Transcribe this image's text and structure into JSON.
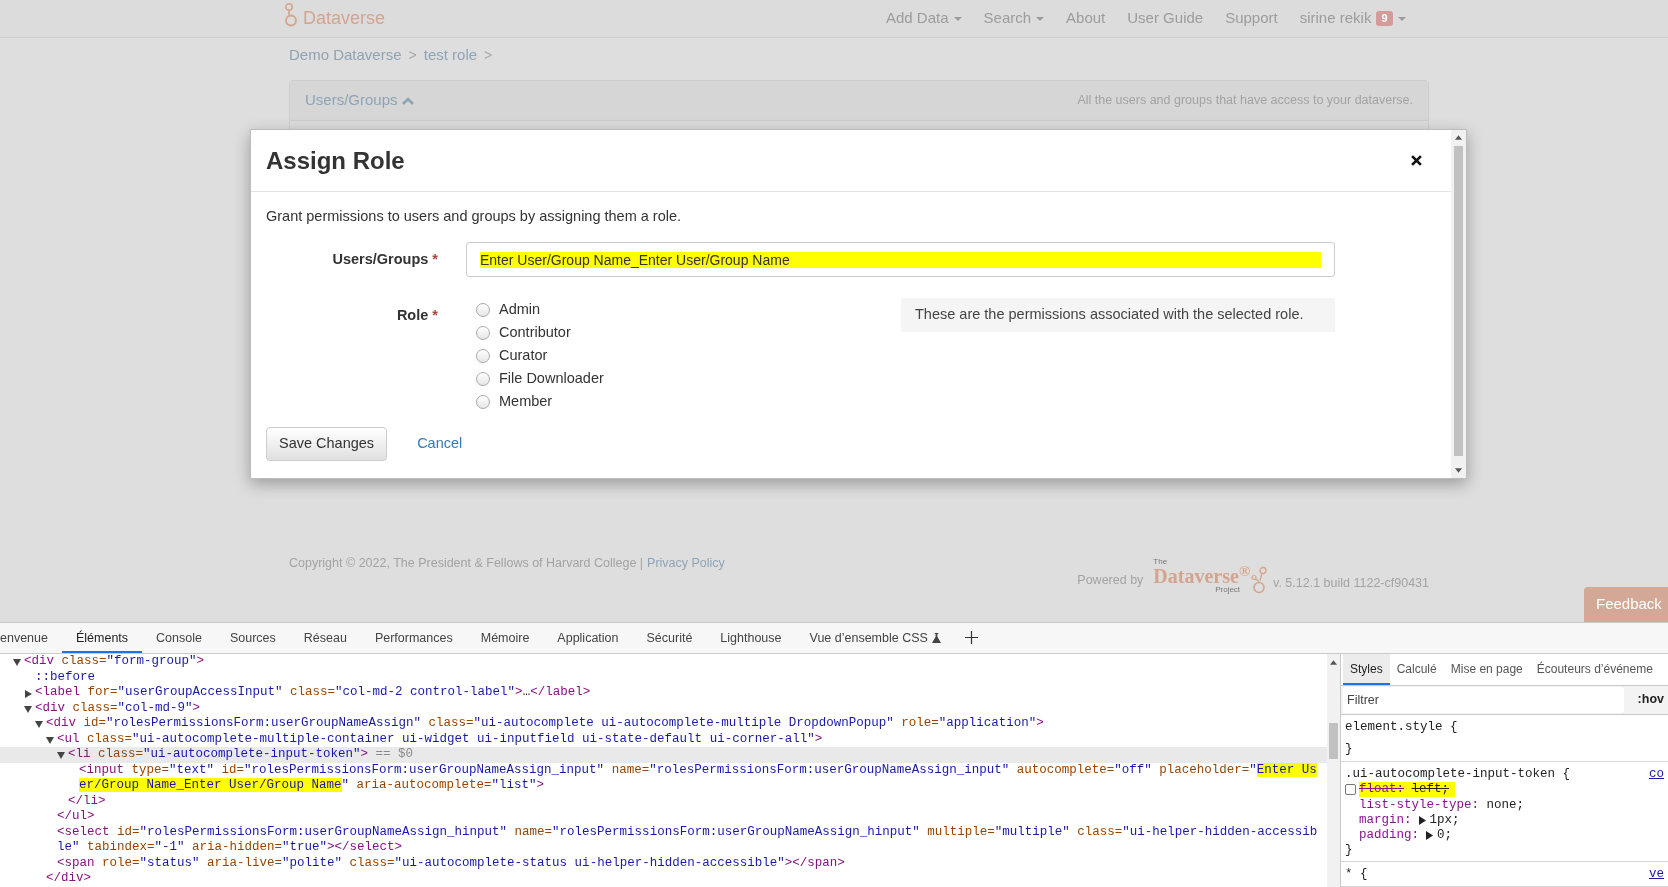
{
  "navbar": {
    "brand": "Dataverse",
    "items": [
      {
        "label": "Add Data",
        "dropdown": true
      },
      {
        "label": "Search",
        "dropdown": true
      },
      {
        "label": "About",
        "dropdown": false
      },
      {
        "label": "User Guide",
        "dropdown": false
      },
      {
        "label": "Support",
        "dropdown": false
      },
      {
        "label": "sirine rekik",
        "dropdown": true,
        "badge": "9"
      }
    ]
  },
  "breadcrumb": {
    "separator": ">",
    "items": [
      "Demo Dataverse",
      "test role"
    ]
  },
  "panel": {
    "title": "Users/Groups",
    "expanded": true,
    "description": "All the users and groups that have access to your dataverse."
  },
  "modal": {
    "title": "Assign Role",
    "intro": "Grant permissions to users and groups by assigning them a role.",
    "users_field": {
      "label": "Users/Groups",
      "required_mark": "*",
      "placeholder": "Enter User/Group Name_Enter User/Group Name",
      "highlight": true
    },
    "role": {
      "label": "Role",
      "required_mark": "*",
      "options": [
        {
          "label": "Admin",
          "selected": false
        },
        {
          "label": "Contributor",
          "selected": false
        },
        {
          "label": "Curator",
          "selected": false
        },
        {
          "label": "File Downloader",
          "selected": false
        },
        {
          "label": "Member",
          "selected": false
        }
      ]
    },
    "permissions_note": "These are the permissions associated with the selected role.",
    "buttons": [
      {
        "label": "Save Changes",
        "kind": "button"
      },
      {
        "label": "Cancel",
        "kind": "link"
      }
    ]
  },
  "footer": {
    "copyright": "Copyright © 2022, The President & Fellows of Harvard College |",
    "privacy_link": "Privacy Policy",
    "powered_by": "Powered by",
    "logo": {
      "top": "The",
      "name": "Dataverse$^{®}$",
      "bottom": "Project"
    },
    "version": "v. 5.12.1 build 1122-cf90431"
  },
  "feedback": "Feedback",
  "devtools": {
    "tabs": [
      {
        "label": "envenue",
        "selected": false
      },
      {
        "label": "Éléments",
        "selected": true
      },
      {
        "label": "Console",
        "selected": false
      },
      {
        "label": "Sources",
        "selected": false
      },
      {
        "label": "Réseau",
        "selected": false
      },
      {
        "label": "Performances",
        "selected": false
      },
      {
        "label": "Mémoire",
        "selected": false
      },
      {
        "label": "Application",
        "selected": false
      },
      {
        "label": "Sécurité",
        "selected": false
      },
      {
        "label": "Lighthouse",
        "selected": false
      },
      {
        "label": "Vue d’ensemble CSS",
        "selected": false,
        "experimental": true
      }
    ],
    "dom_tree": [
      {
        "selected": false,
        "expanded": true,
        "open": [
          {
            "kind": "tag",
            "text": "<div"
          },
          {
            "kind": "attr",
            "text": " class="
          },
          {
            "kind": "val",
            "text": "\"form-group\""
          },
          {
            "kind": "tag",
            "text": ">"
          }
        ],
        "children": [
          {
            "selected": false,
            "open": [
              {
                "kind": "pseudo",
                "text": "::before"
              }
            ]
          },
          {
            "selected": false,
            "expanded": false,
            "open": [
              {
                "kind": "tag",
                "text": "<label"
              },
              {
                "kind": "attr",
                "text": " for="
              },
              {
                "kind": "val",
                "text": "\"userGroupAccessInput\""
              },
              {
                "kind": "attr",
                "text": " class="
              },
              {
                "kind": "val",
                "text": "\"col-md-2 control-label\""
              },
              {
                "kind": "tag",
                "text": ">"
              },
              {
                "kind": "plain",
                "text": "…"
              },
              {
                "kind": "tag",
                "text": "</label>"
              }
            ]
          },
          {
            "selected": false,
            "expanded": true,
            "open": [
              {
                "kind": "tag",
                "text": "<div"
              },
              {
                "kind": "attr",
                "text": " class="
              },
              {
                "kind": "val",
                "text": "\"col-md-9\""
              },
              {
                "kind": "tag",
                "text": ">"
              }
            ],
            "children": [
              {
                "selected": false,
                "expanded": true,
                "open": [
                  {
                    "kind": "tag",
                    "text": "<div"
                  },
                  {
                    "kind": "attr",
                    "text": " id="
                  },
                  {
                    "kind": "val",
                    "text": "\"rolesPermissionsForm:userGroupNameAssign\""
                  },
                  {
                    "kind": "attr",
                    "text": " class="
                  },
                  {
                    "kind": "val",
                    "text": "\"ui-autocomplete ui-autocomplete-multiple DropdownPopup\""
                  },
                  {
                    "kind": "attr",
                    "text": " role="
                  },
                  {
                    "kind": "val",
                    "text": "\"application\""
                  },
                  {
                    "kind": "tag",
                    "text": ">"
                  }
                ],
                "close": [
                  {
                    "kind": "tag",
                    "text": "</div>"
                  }
                ],
                "children": [
                  {
                    "selected": false,
                    "expanded": true,
                    "open": [
                      {
                        "kind": "tag",
                        "text": "<ul"
                      },
                      {
                        "kind": "attr",
                        "text": " class="
                      },
                      {
                        "kind": "val",
                        "text": "\"ui-autocomplete-multiple-container ui-widget ui-inputfield ui-state-default ui-corner-all\""
                      },
                      {
                        "kind": "tag",
                        "text": ">"
                      }
                    ],
                    "close": [
                      {
                        "kind": "tag",
                        "text": "</ul>"
                      }
                    ],
                    "children": [
                      {
                        "selected": true,
                        "expanded": true,
                        "open": [
                          {
                            "kind": "tag",
                            "text": "<li"
                          },
                          {
                            "kind": "attr",
                            "text": " class="
                          },
                          {
                            "kind": "val",
                            "text": "\"ui-autocomplete-input-token\""
                          },
                          {
                            "kind": "tag",
                            "text": ">"
                          },
                          {
                            "kind": "hint",
                            "text": " == $0"
                          }
                        ],
                        "close": [
                          {
                            "kind": "tag",
                            "text": "</li>"
                          }
                        ],
                        "children": [
                          {
                            "selected": false,
                            "open": [
                              {
                                "kind": "tag",
                                "text": "<input"
                              },
                              {
                                "kind": "attr",
                                "text": " type="
                              },
                              {
                                "kind": "val",
                                "text": "\"text\""
                              },
                              {
                                "kind": "attr",
                                "text": " id="
                              },
                              {
                                "kind": "val",
                                "text": "\"rolesPermissionsForm:userGroupNameAssign_input\""
                              },
                              {
                                "kind": "attr",
                                "text": " name="
                              },
                              {
                                "kind": "val",
                                "text": "\"rolesPermissionsForm:userGroupNameAssign_input\""
                              },
                              {
                                "kind": "attr",
                                "text": " autocomplete="
                              },
                              {
                                "kind": "val",
                                "text": "\"off\""
                              },
                              {
                                "kind": "attr",
                                "text": " placeholder="
                              },
                              {
                                "kind": "val",
                                "text": "\""
                              },
                              {
                                "kind": "val",
                                "text": "Enter User/Group Name_Enter User/Group Name",
                                "highlight": true
                              },
                              {
                                "kind": "val",
                                "text": "\""
                              },
                              {
                                "kind": "attr",
                                "text": " aria-autocomplete="
                              },
                              {
                                "kind": "val",
                                "text": "\"list\""
                              },
                              {
                                "kind": "tag",
                                "text": ">"
                              }
                            ]
                          }
                        ]
                      }
                    ]
                  },
                  {
                    "selected": false,
                    "open": [
                      {
                        "kind": "tag",
                        "text": "<select"
                      },
                      {
                        "kind": "attr",
                        "text": " id="
                      },
                      {
                        "kind": "val",
                        "text": "\"rolesPermissionsForm:userGroupNameAssign_hinput\""
                      },
                      {
                        "kind": "attr",
                        "text": " name="
                      },
                      {
                        "kind": "val",
                        "text": "\"rolesPermissionsForm:userGroupNameAssign_hinput\""
                      },
                      {
                        "kind": "attr",
                        "text": " multiple="
                      },
                      {
                        "kind": "val",
                        "text": "\"multiple\""
                      },
                      {
                        "kind": "attr",
                        "text": " class="
                      },
                      {
                        "kind": "val",
                        "text": "\"ui-helper-hidden-accessible\""
                      },
                      {
                        "kind": "attr",
                        "text": " tabindex="
                      },
                      {
                        "kind": "val",
                        "text": "\"-1\""
                      },
                      {
                        "kind": "attr",
                        "text": " aria-hidden="
                      },
                      {
                        "kind": "val",
                        "text": "\"true\""
                      },
                      {
                        "kind": "tag",
                        "text": "></select>"
                      }
                    ]
                  },
                  {
                    "selected": false,
                    "open": [
                      {
                        "kind": "tag",
                        "text": "<span"
                      },
                      {
                        "kind": "attr",
                        "text": " role="
                      },
                      {
                        "kind": "val",
                        "text": "\"status\""
                      },
                      {
                        "kind": "attr",
                        "text": " aria-live="
                      },
                      {
                        "kind": "val",
                        "text": "\"polite\""
                      },
                      {
                        "kind": "attr",
                        "text": " class="
                      },
                      {
                        "kind": "val",
                        "text": "\"ui-autocomplete-status ui-helper-hidden-accessible\""
                      },
                      {
                        "kind": "tag",
                        "text": "></span>"
                      }
                    ]
                  }
                ]
              }
            ]
          }
        ]
      }
    ],
    "styles_pane": {
      "tabs": [
        {
          "label": "Styles",
          "selected": true
        },
        {
          "label": "Calculé",
          "selected": false
        },
        {
          "label": "Mise en page",
          "selected": false
        },
        {
          "label": "Écouteurs d’événeme",
          "selected": false
        }
      ],
      "filter_placeholder": "Filtrer",
      "hov": ":hov",
      "rules": [
        {
          "selector": "element.style {",
          "close": "}"
        },
        {
          "selector": ".ui-autocomplete-input-token {",
          "source": "co",
          "close": "}",
          "properties": [
            {
              "name": "float:",
              "value": "left;",
              "enabled": false,
              "highlight": true
            },
            {
              "name": "list-style-type:",
              "value": "none;",
              "enabled": true
            },
            {
              "name": "margin:",
              "value": "1px;",
              "enabled": true,
              "expandable": true
            },
            {
              "name": "padding:",
              "value": "0;",
              "enabled": true,
              "expandable": true
            }
          ]
        },
        {
          "selector": "* {",
          "source": "ve"
        }
      ]
    }
  }
}
